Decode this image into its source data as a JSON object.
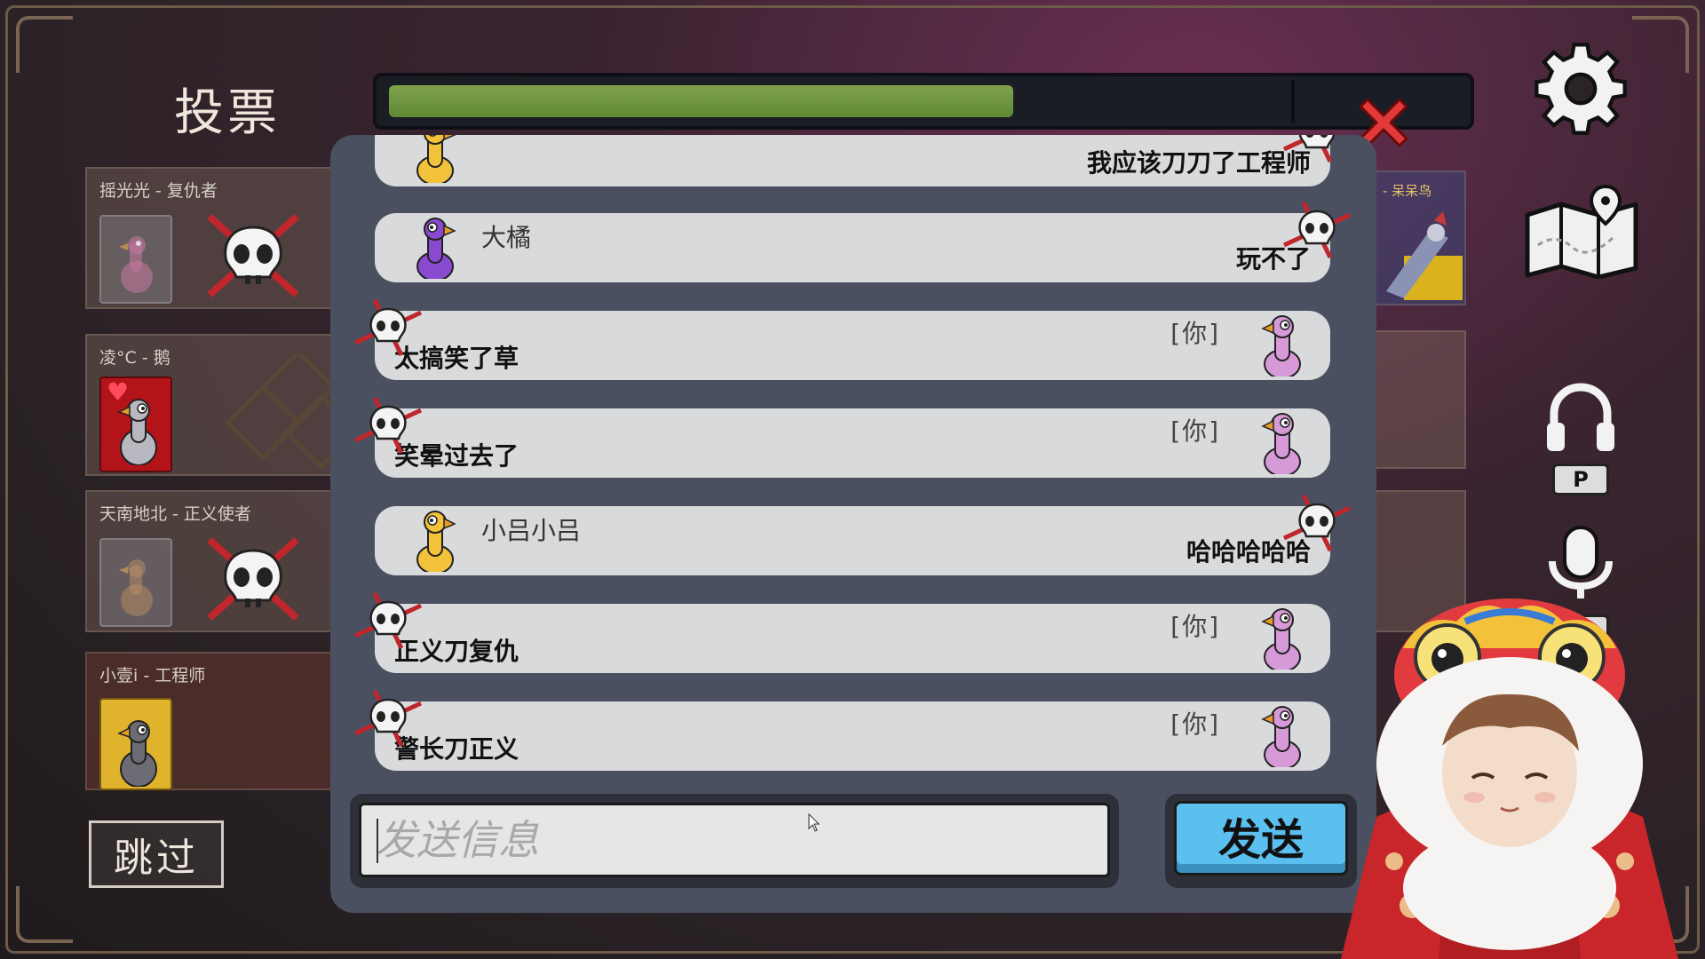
{
  "header": {
    "title": "投票",
    "timer_progress": 0.58
  },
  "players": [
    {
      "label": "摇光光 - 复仇者",
      "status": "dead"
    },
    {
      "label": "凌°C - 鹅",
      "status": "alive"
    },
    {
      "label": "天南地北 - 正义使者",
      "status": "dead"
    },
    {
      "label": "小壹i - 工程师",
      "status": "alive"
    }
  ],
  "right_players": [
    {
      "label": "- 呆呆鸟"
    }
  ],
  "skip_label": "跳过",
  "controls": {
    "push_to_talk_key": "P"
  },
  "chat": {
    "messages": [
      {
        "sender": "",
        "text": "我应该刀刀了工程师",
        "is_you": false,
        "dead": true
      },
      {
        "sender": "大橘",
        "text": "玩不了",
        "is_you": false,
        "dead": true
      },
      {
        "sender": "",
        "text": "太搞笑了草",
        "is_you": true,
        "you_tag": "[你]",
        "dead": true
      },
      {
        "sender": "",
        "text": "笑晕过去了",
        "is_you": true,
        "you_tag": "[你]",
        "dead": true
      },
      {
        "sender": "小吕小吕",
        "text": "哈哈哈哈哈",
        "is_you": false,
        "dead": true
      },
      {
        "sender": "",
        "text": "正义刀复仇",
        "is_you": true,
        "you_tag": "[你]",
        "dead": true
      },
      {
        "sender": "",
        "text": "警长刀正义",
        "is_you": true,
        "you_tag": "[你]",
        "dead": true
      }
    ],
    "input_placeholder": "发送信息",
    "input_value": "",
    "send_label": "发送"
  },
  "colors": {
    "timer_fill": "#6f9640",
    "send_button": "#5bc0f0",
    "close_x": "#e23a3a",
    "panel": "#4a5060"
  }
}
